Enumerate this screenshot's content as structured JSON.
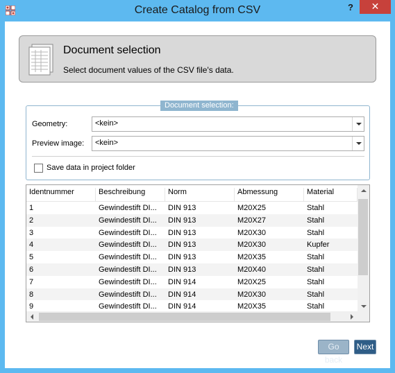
{
  "window": {
    "title": "Create Catalog from CSV",
    "help_label": "?",
    "close_label": "✕"
  },
  "header": {
    "title": "Document selection",
    "subtitle": "Select document values of the CSV file's data."
  },
  "group": {
    "caption": "Document selection:",
    "geometry_label": "Geometry:",
    "geometry_value": "<kein>",
    "preview_label": "Preview image:",
    "preview_value": "<kein>",
    "save_label": "Save data in project folder",
    "save_checked": false
  },
  "table": {
    "columns": [
      "Identnummer",
      "Beschreibung",
      "Norm",
      "Abmessung",
      "Material"
    ],
    "rows": [
      [
        "1",
        "Gewindestift DI...",
        "DIN 913",
        "M20X25",
        "Stahl"
      ],
      [
        "2",
        "Gewindestift DI...",
        "DIN 913",
        "M20X27",
        "Stahl"
      ],
      [
        "3",
        "Gewindestift DI...",
        "DIN 913",
        "M20X30",
        "Stahl"
      ],
      [
        "4",
        "Gewindestift DI...",
        "DIN 913",
        "M20X30",
        "Kupfer"
      ],
      [
        "5",
        "Gewindestift DI...",
        "DIN 913",
        "M20X35",
        "Stahl"
      ],
      [
        "6",
        "Gewindestift DI...",
        "DIN 913",
        "M20X40",
        "Stahl"
      ],
      [
        "7",
        "Gewindestift DI...",
        "DIN 914",
        "M20X25",
        "Stahl"
      ],
      [
        "8",
        "Gewindestift DI...",
        "DIN 914",
        "M20X30",
        "Stahl"
      ],
      [
        "9",
        "Gewindestift DI...",
        "DIN 914",
        "M20X35",
        "Stahl"
      ]
    ]
  },
  "footer": {
    "back_label": "Go back",
    "next_label": "Next"
  },
  "colors": {
    "title_bar": "#5db9f0",
    "close": "#c7413b",
    "accent": "#2f5d87",
    "group_border": "#8fb5cf"
  }
}
